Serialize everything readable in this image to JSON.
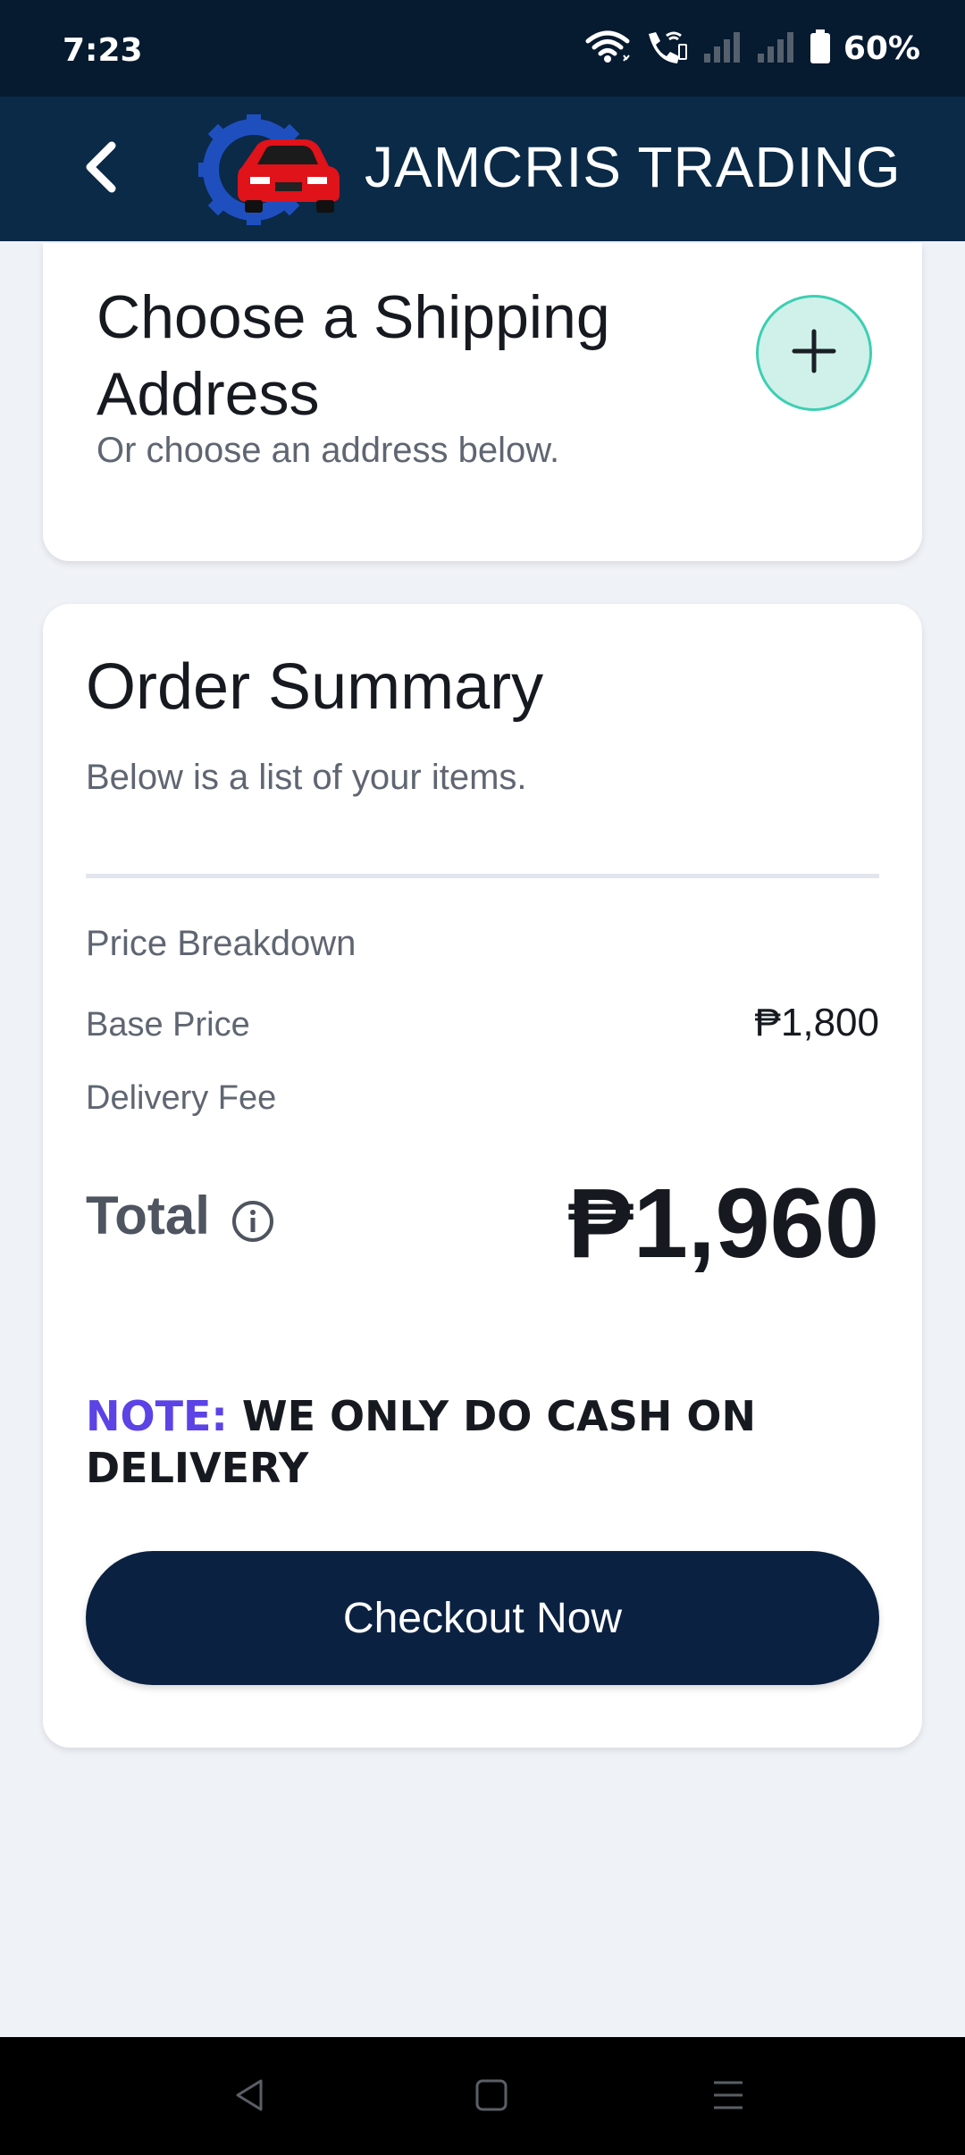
{
  "status_bar": {
    "time": "7:23",
    "battery": "60%",
    "icons": [
      "wifi-icon",
      "wifi-call-icon",
      "signal-icon",
      "signal-icon",
      "battery-icon"
    ]
  },
  "header": {
    "title": "JAMCRIS TRADING",
    "back_icon": "chevron-left-icon",
    "logo": "gear-car-logo"
  },
  "shipping": {
    "title": "Choose a Shipping Address",
    "subtitle": "Or choose an address below.",
    "add_icon": "plus-icon"
  },
  "order_summary": {
    "title": "Order Summary",
    "subtitle": "Below is a list of your items.",
    "breakdown_label": "Price Breakdown",
    "base_price_label": "Base Price",
    "base_price_value": "₱1,800",
    "delivery_fee_label": "Delivery Fee",
    "total_label": "Total",
    "total_value": "₱1,960",
    "note_prefix": "NOTE:",
    "note_text": " WE ONLY DO CASH ON DELIVERY",
    "checkout_label": "Checkout Now"
  },
  "colors": {
    "header_bg": "#0a2a47",
    "status_bg": "#061a30",
    "accent_teal": "#3ccfb2",
    "note_purple": "#5b43e6",
    "button_navy": "#0b2142",
    "page_bg": "#eff2f7"
  },
  "nav_bar": {
    "icons": [
      "back-triangle-icon",
      "home-square-icon",
      "menu-lines-icon"
    ]
  }
}
